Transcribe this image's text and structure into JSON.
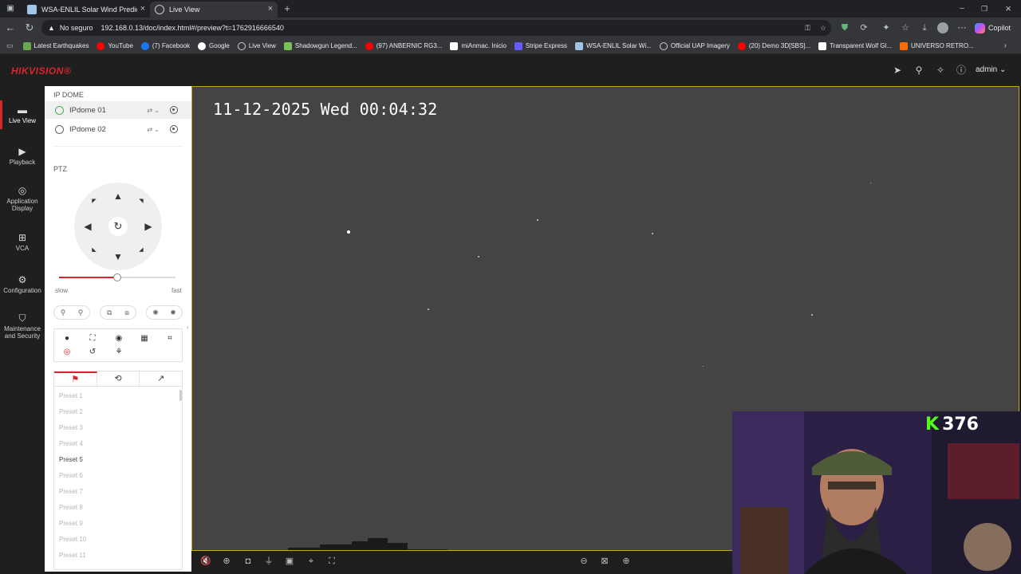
{
  "browser": {
    "tabs": [
      {
        "title": "WSA-ENLIL Solar Wind Prediction",
        "active": false
      },
      {
        "title": "Live View",
        "active": true
      }
    ],
    "security_label": "No seguro",
    "url": "192.168.0.13/doc/index.html#/preview?t=1762916666540",
    "copilot_label": "Copilot",
    "bookmarks": [
      {
        "label": "Latest Earthquakes",
        "color": "#6aa84f"
      },
      {
        "label": "YouTube",
        "color": "#ff0000"
      },
      {
        "label": "(7) Facebook",
        "color": "#1877f2"
      },
      {
        "label": "Google",
        "color": "#ffffff"
      },
      {
        "label": "Live View",
        "color": "#cccccc"
      },
      {
        "label": "Shadowgun Legend...",
        "color": "#78c257"
      },
      {
        "label": "(97) ANBERNIC RG3...",
        "color": "#ff0000"
      },
      {
        "label": "miAnmac. Inicio",
        "color": "#ffffff"
      },
      {
        "label": "Stripe Express",
        "color": "#635bff"
      },
      {
        "label": "WSA-ENLIL Solar Wi...",
        "color": "#9fc5e8"
      },
      {
        "label": "Official UAP Imagery",
        "color": "#cccccc"
      },
      {
        "label": "(20) Demo 3D[SBS]...",
        "color": "#ff0000"
      },
      {
        "label": "Transparent Wolf Gl...",
        "color": "#ffffff"
      },
      {
        "label": "UNIVERSO RETRO...",
        "color": "#ff6d00"
      }
    ]
  },
  "app": {
    "brand": "HIKVISION®",
    "user": "admin",
    "nav": [
      {
        "label": "Live View",
        "icon": "monitor-icon",
        "active": true
      },
      {
        "label": "Playback",
        "icon": "playback-icon",
        "active": false
      },
      {
        "label": "Application Display",
        "icon": "application-icon",
        "active": false
      },
      {
        "label": "VCA",
        "icon": "vca-icon",
        "active": false
      },
      {
        "label": "Configuration",
        "icon": "gear-icon",
        "active": false
      },
      {
        "label": "Maintenance and Security",
        "icon": "shield-icon",
        "active": false
      }
    ],
    "panel": {
      "group_title": "IP DOME",
      "devices": [
        {
          "name": "IPdome 01",
          "selected": true
        },
        {
          "name": "IPdome 02",
          "selected": false
        }
      ],
      "ptz_title": "PTZ",
      "speed_min_label": "slow",
      "speed_max_label": "fast",
      "speed_level": 0.5,
      "presets": [
        "Preset 1",
        "Preset 2",
        "Preset 3",
        "Preset 4",
        "Preset 5",
        "Preset 6",
        "Preset 7",
        "Preset 8",
        "Preset 9",
        "Preset 10",
        "Preset 11"
      ],
      "active_preset": "Preset 5"
    },
    "video": {
      "osd_timestamp": "11-12-2025 Wed 00:04:32"
    }
  },
  "stream_overlay": {
    "kick_count": "376",
    "kick_letter": "K",
    "kick_color": "#53fc18"
  }
}
